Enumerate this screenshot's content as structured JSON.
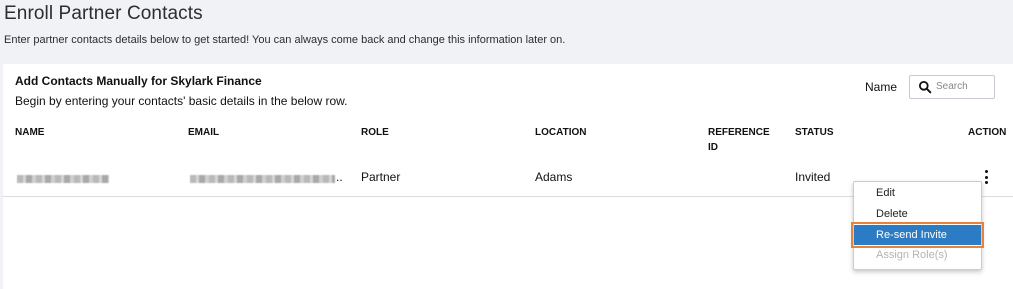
{
  "page": {
    "title": "Enroll Partner Contacts",
    "subtitle": "Enter partner contacts details below to get started! You can always come back and change this information later on."
  },
  "card": {
    "title": "Add Contacts Manually for Skylark Finance",
    "description": "Begin by entering your contacts' basic details in the below row.",
    "filter_label": "Name",
    "search": {
      "placeholder": "Search",
      "value": ""
    }
  },
  "table": {
    "columns": {
      "name": "NAME",
      "email": "EMAIL",
      "role": "ROLE",
      "location": "LOCATION",
      "reference_id": "REFERENCE ID",
      "status": "STATUS",
      "action": "ACTION"
    },
    "rows": [
      {
        "name": "",
        "email": "",
        "email_suffix": "..",
        "role": "Partner",
        "location": "Adams",
        "reference_id": "",
        "status": "Invited"
      }
    ]
  },
  "action_menu": {
    "items": [
      {
        "label": "Edit",
        "state": "normal"
      },
      {
        "label": "Delete",
        "state": "normal"
      },
      {
        "label": "Re-send Invite",
        "state": "selected"
      },
      {
        "label": "Assign Role(s)",
        "state": "disabled"
      }
    ]
  },
  "colors": {
    "page_background": "#f0f2f5",
    "card_background": "#ffffff",
    "menu_selected": "#2b7bc5",
    "selection_outline": "#e8823a"
  }
}
